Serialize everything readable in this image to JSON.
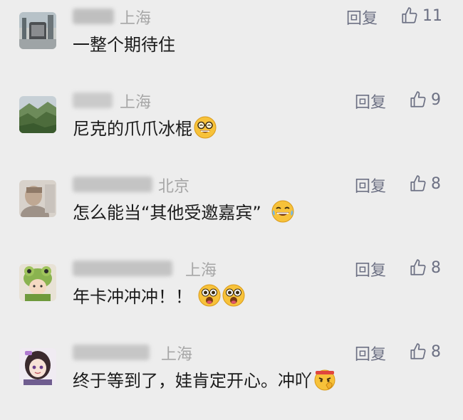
{
  "comments": [
    {
      "location": "上海",
      "reply_label": "回复",
      "likes": "11",
      "text": "一整个期待住",
      "emojis": [],
      "avatar": "city-photo-avatar"
    },
    {
      "location": "上海",
      "reply_label": "回复",
      "likes": "9",
      "text": "尼克的爪爪冰棍",
      "emojis": [
        "grinning-glasses-emoji"
      ],
      "avatar": "mountain-photo-avatar"
    },
    {
      "location": "北京",
      "reply_label": "回复",
      "likes": "8",
      "text": "怎么能当“其他受邀嘉宾”",
      "emojis": [
        "laughing-tears-emoji"
      ],
      "avatar": "portrait-photo-avatar"
    },
    {
      "location": "上海",
      "reply_label": "回复",
      "likes": "8",
      "text": "年卡冲冲冲！！",
      "emojis": [
        "excited-face-emoji",
        "excited-face-emoji"
      ],
      "avatar": "frog-hat-girl-avatar"
    },
    {
      "location": "上海",
      "reply_label": "回复",
      "likes": "8",
      "text": "终于等到了，娃肯定开心。冲吖",
      "emojis": [
        "strong-face-emoji"
      ],
      "avatar": "anime-girl-avatar"
    }
  ],
  "colors": {
    "background": "#ededed",
    "reply": "#6d7184",
    "location": "#a6a6a6",
    "text": "#1b1b1b"
  }
}
